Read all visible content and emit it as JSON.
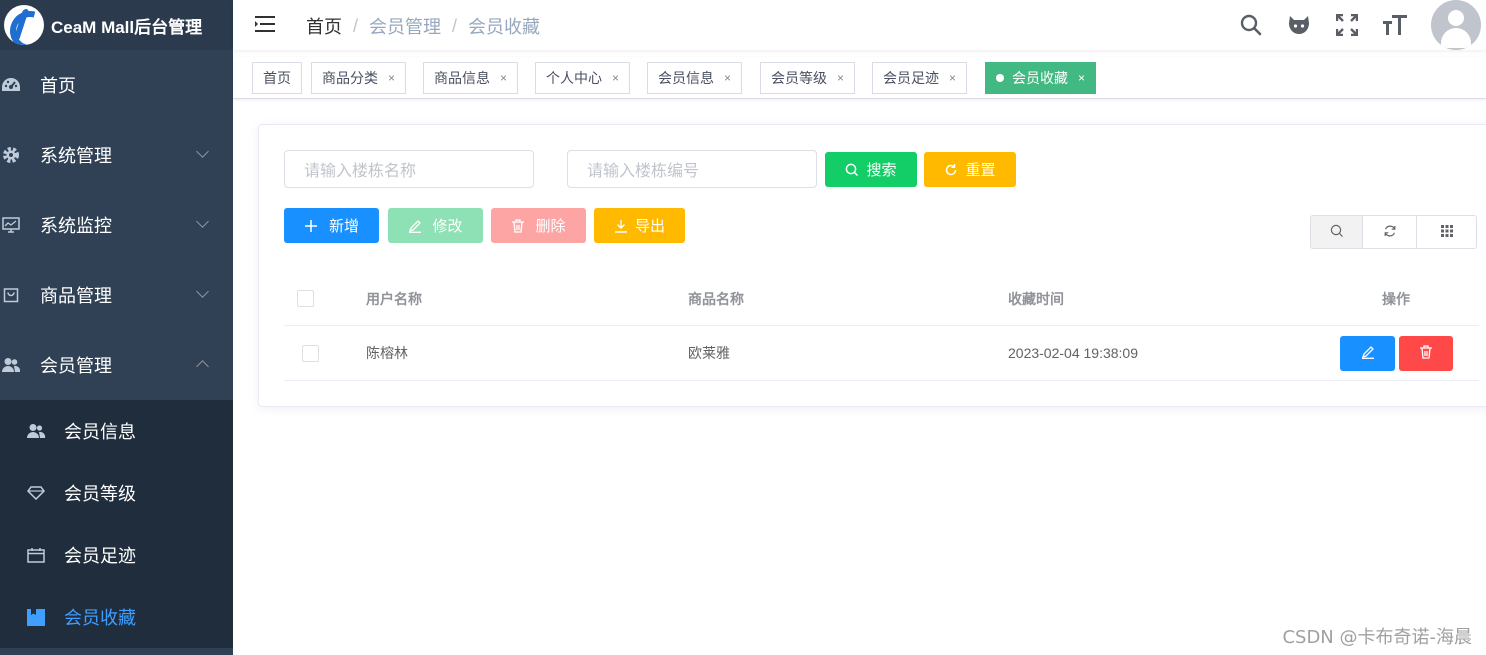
{
  "app": {
    "title": "CeaM Mall后台管理"
  },
  "sidebar": {
    "items": [
      {
        "label": "首页",
        "icon": "dashboard-icon"
      },
      {
        "label": "系统管理",
        "icon": "gear-icon"
      },
      {
        "label": "系统监控",
        "icon": "monitor-icon"
      },
      {
        "label": "商品管理",
        "icon": "shopping-bag-icon"
      },
      {
        "label": "会员管理",
        "icon": "user-group-icon"
      }
    ],
    "submenu": [
      {
        "label": "会员信息",
        "icon": "people-icon"
      },
      {
        "label": "会员等级",
        "icon": "diamond-icon"
      },
      {
        "label": "会员足迹",
        "icon": "calendar-icon"
      },
      {
        "label": "会员收藏",
        "icon": "bookmark-icon",
        "active": true
      }
    ]
  },
  "breadcrumb": {
    "first": "首页",
    "second": "会员管理",
    "third": "会员收藏",
    "separator": "/"
  },
  "tags": [
    "首页",
    "商品分类",
    "商品信息",
    "个人中心",
    "会员信息",
    "会员等级",
    "会员足迹",
    "会员收藏"
  ],
  "tag_close": "×",
  "search": {
    "name_placeholder": "请输入楼栋名称",
    "code_placeholder": "请输入楼栋编号",
    "search_label": "搜索",
    "reset_label": "重置"
  },
  "toolbar": {
    "add": "新增",
    "edit": "修改",
    "delete": "删除",
    "export": "导出"
  },
  "table": {
    "columns": [
      "用户名称",
      "商品名称",
      "收藏时间",
      "操作"
    ],
    "rows": [
      {
        "user": "陈榕林",
        "product": "欧莱雅",
        "time": "2023-02-04 19:38:09"
      }
    ]
  },
  "watermark": "CSDN @卡布奇诺-海晨",
  "colors": {
    "sidebar": "#304156",
    "active": "#409eff",
    "tag_active": "#42b983",
    "success": "#13ce66",
    "warning": "#ffba00",
    "primary": "#1890ff",
    "danger": "#ff4949"
  }
}
